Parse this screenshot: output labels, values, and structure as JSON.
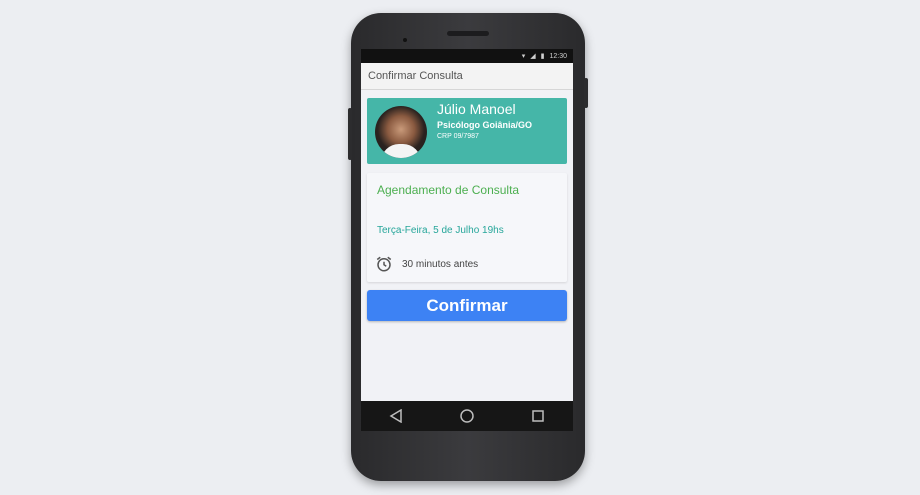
{
  "status_bar": {
    "time": "12:30"
  },
  "app_bar": {
    "title": "Confirmar Consulta"
  },
  "doctor": {
    "name": "Júlio Manoel",
    "specialty": "Psicólogo Goiânia/GO",
    "registration": "CRP 09/7987"
  },
  "appointment": {
    "title": "Agendamento de Consulta",
    "date": "Terça-Feira, 5 de Julho 19hs",
    "reminder_icon": "alarm-clock-icon",
    "reminder": "30 minutos antes"
  },
  "actions": {
    "confirm_label": "Confirmar"
  },
  "nav": {
    "icons": [
      "back-icon",
      "home-icon",
      "recents-icon"
    ]
  },
  "colors": {
    "profile_card": "#45b6a8",
    "appt_title": "#4caf50",
    "appt_date": "#26a69a",
    "confirm_button": "#3d82f4"
  }
}
